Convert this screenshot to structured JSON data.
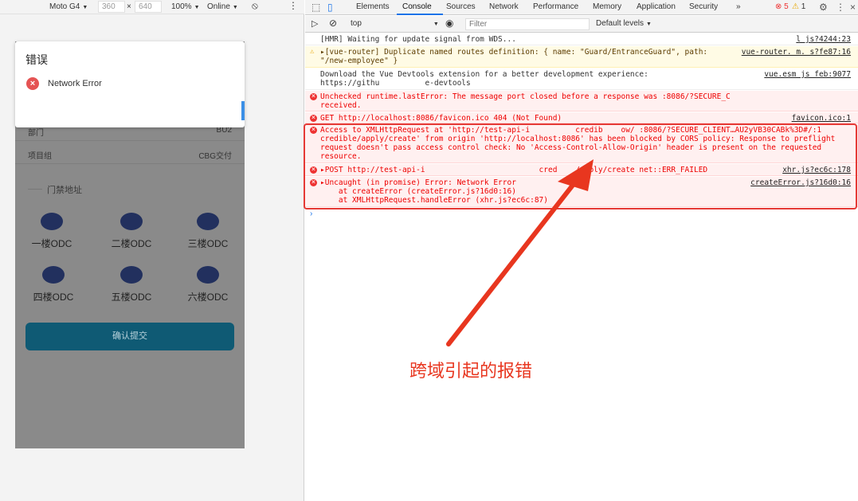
{
  "device_toolbar": {
    "device": "Moto G4",
    "width": "360",
    "times": "×",
    "height": "640",
    "zoom": "100%",
    "network": "Online"
  },
  "phone": {
    "dialog": {
      "title": "错误",
      "message": "Network Error"
    },
    "rows": [
      {
        "label": "部门",
        "value": "BU2"
      },
      {
        "label": "项目组",
        "value": "CBG交付"
      }
    ],
    "section_title": "门禁地址",
    "odc_items": [
      "一楼ODC",
      "二楼ODC",
      "三楼ODC",
      "四楼ODC",
      "五楼ODC",
      "六楼ODC"
    ],
    "submit_label": "确认提交"
  },
  "devtools": {
    "tabs": [
      "Elements",
      "Console",
      "Sources",
      "Network",
      "Performance",
      "Memory",
      "Application",
      "Security"
    ],
    "more": "»",
    "error_count": "5",
    "warning_count": "1",
    "context": "top",
    "filter_placeholder": "Filter",
    "levels": "Default levels"
  },
  "console": [
    {
      "type": "info",
      "text": "[HMR] Waiting for update signal from WDS...",
      "source": "l   js?4244:23"
    },
    {
      "type": "warn",
      "text": "▸[vue-router] Duplicate named routes definition: { name: \"Guard/EntranceGuard\", path:\n\"/new-employee\" }",
      "source": "vue-router.   m. s?fe87:16"
    },
    {
      "type": "info",
      "text": "Download the Vue Devtools extension for a better development experience:\nhttps://githu          e-devtools",
      "source": "vue.esm js  feb:9077"
    },
    {
      "type": "err",
      "text": "Unchecked runtime.lastError: The message port closed before a response was :8086/?SECURE_C\nreceived.",
      "source": ""
    },
    {
      "type": "err",
      "text": "GET http://localhost:8086/favicon.ico 404 (Not Found)",
      "source": "favicon.ico:1"
    },
    {
      "type": "err",
      "text": "Access to XMLHttpRequest at 'http://test-api-i          credib    ow/ :8086/?SECURE_CLIENT…AU2yVB30CABk%3D#/:1\ncredible/apply/create' from origin 'http://localhost:8086' has been blocked by CORS policy: Response to preflight\nrequest doesn't pass access control check: No 'Access-Control-Allow-Origin' header is present on the requested\nresource.",
      "source": ""
    },
    {
      "type": "err",
      "text": "▸POST http://test-api-i                         cred    /apply/create net::ERR_FAILED",
      "source": "xhr.js?ec6c:178"
    },
    {
      "type": "err",
      "text": "▸Uncaught (in promise) Error: Network Error\n    at createError (createError.js?16d0:16)\n    at XMLHttpRequest.handleError (xhr.js?ec6c:87)",
      "source": "createError.js?16d0:16"
    }
  ],
  "annotation": "跨域引起的报错",
  "colors": {
    "accent": "#1a73e8",
    "error": "#e53935",
    "annotation": "#e8361f"
  }
}
